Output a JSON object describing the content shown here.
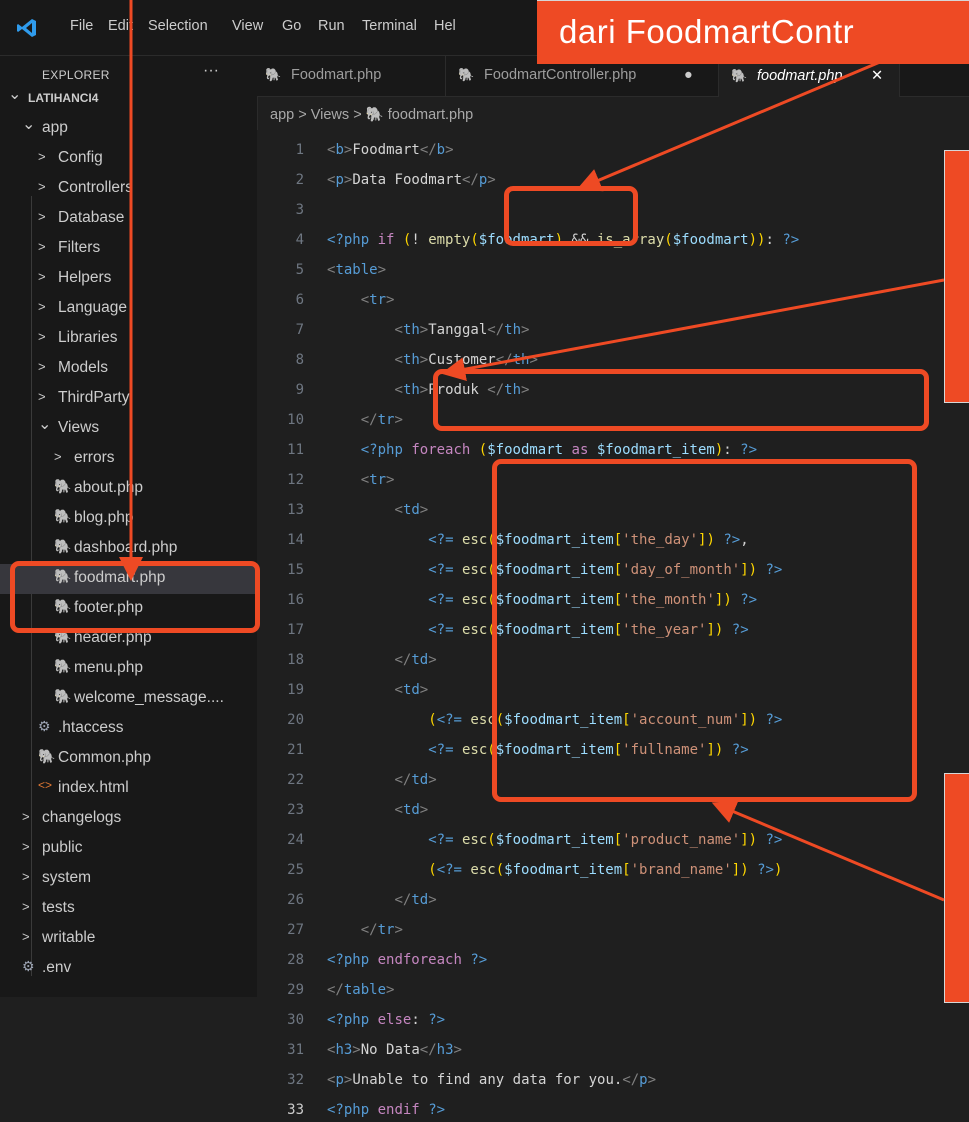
{
  "titlebar": {
    "menu": [
      "File",
      "Edit",
      "Selection",
      "View",
      "Go",
      "Run",
      "Terminal",
      "Hel"
    ]
  },
  "callout": {
    "top_text": "dari FoodmartContr"
  },
  "sidebar": {
    "title": "EXPLORER",
    "more": "···",
    "items": [
      {
        "label": "LATIHANCI4",
        "icon": "chevron-down-icon"
      },
      {
        "label": "app",
        "icon": "chevron-down-icon"
      },
      {
        "label": "Config",
        "icon": "chevron-right-icon"
      },
      {
        "label": "Controllers",
        "icon": "chevron-right-icon"
      },
      {
        "label": "Database",
        "icon": "chevron-right-icon"
      },
      {
        "label": "Filters",
        "icon": "chevron-right-icon"
      },
      {
        "label": "Helpers",
        "icon": "chevron-right-icon"
      },
      {
        "label": "Language",
        "icon": "chevron-right-icon"
      },
      {
        "label": "Libraries",
        "icon": "chevron-right-icon"
      },
      {
        "label": "Models",
        "icon": "chevron-right-icon"
      },
      {
        "label": "ThirdParty",
        "icon": "chevron-right-icon"
      },
      {
        "label": "Views",
        "icon": "chevron-down-icon"
      },
      {
        "label": "errors",
        "icon": "chevron-right-icon"
      },
      {
        "label": "about.php",
        "icon": "php-file-icon"
      },
      {
        "label": "blog.php",
        "icon": "php-file-icon"
      },
      {
        "label": "dashboard.php",
        "icon": "php-file-icon"
      },
      {
        "label": "foodmart.php",
        "icon": "php-file-icon"
      },
      {
        "label": "footer.php",
        "icon": "php-file-icon"
      },
      {
        "label": "header.php",
        "icon": "php-file-icon"
      },
      {
        "label": "menu.php",
        "icon": "php-file-icon"
      },
      {
        "label": "welcome_message....",
        "icon": "php-file-icon"
      },
      {
        "label": ".htaccess",
        "icon": "gear-icon"
      },
      {
        "label": "Common.php",
        "icon": "php-file-icon"
      },
      {
        "label": "index.html",
        "icon": "html-file-icon"
      },
      {
        "label": "changelogs",
        "icon": "chevron-right-icon"
      },
      {
        "label": "public",
        "icon": "chevron-right-icon"
      },
      {
        "label": "system",
        "icon": "chevron-right-icon"
      },
      {
        "label": "tests",
        "icon": "chevron-right-icon"
      },
      {
        "label": "writable",
        "icon": "chevron-right-icon"
      },
      {
        "label": ".env",
        "icon": "gear-icon"
      }
    ]
  },
  "tabs": [
    {
      "label": "Foodmart.php",
      "modified": ""
    },
    {
      "label": "FoodmartController.php",
      "modified": "●"
    },
    {
      "label": "foodmart.php",
      "close": "✕"
    }
  ],
  "breadcrumb": {
    "part1": "app",
    "sep": ">",
    "part2": "Views",
    "part3": "foodmart.php"
  },
  "editor": {
    "current_line": 33,
    "lines": [
      {
        "n": "1",
        "text": "<b>Foodmart</b>"
      },
      {
        "n": "2",
        "text": "<p>Data Foodmart</p>"
      },
      {
        "n": "3",
        "text": ""
      },
      {
        "n": "4",
        "text": "<?php if (! empty($foodmart) && is_array($foodmart)): ?>"
      },
      {
        "n": "5",
        "text": "<table>"
      },
      {
        "n": "6",
        "text": "    <tr>"
      },
      {
        "n": "7",
        "text": "        <th>Tanggal</th>"
      },
      {
        "n": "8",
        "text": "        <th>Customer</th>"
      },
      {
        "n": "9",
        "text": "        <th>Produk </th>"
      },
      {
        "n": "10",
        "text": "    </tr>"
      },
      {
        "n": "11",
        "text": "    <?php foreach ($foodmart as $foodmart_item): ?>"
      },
      {
        "n": "12",
        "text": "    <tr>"
      },
      {
        "n": "13",
        "text": "        <td>"
      },
      {
        "n": "14",
        "text": "            <?= esc($foodmart_item['the_day']) ?>,"
      },
      {
        "n": "15",
        "text": "            <?= esc($foodmart_item['day_of_month']) ?>"
      },
      {
        "n": "16",
        "text": "            <?= esc($foodmart_item['the_month']) ?>"
      },
      {
        "n": "17",
        "text": "            <?= esc($foodmart_item['the_year']) ?>"
      },
      {
        "n": "18",
        "text": "        </td>"
      },
      {
        "n": "19",
        "text": "        <td>"
      },
      {
        "n": "20",
        "text": "            (<?= esc($foodmart_item['account_num']) ?>"
      },
      {
        "n": "21",
        "text": "            <?= esc($foodmart_item['fullname']) ?>"
      },
      {
        "n": "22",
        "text": "        </td>"
      },
      {
        "n": "23",
        "text": "        <td>"
      },
      {
        "n": "24",
        "text": "            <?= esc($foodmart_item['product_name']) ?>"
      },
      {
        "n": "25",
        "text": "            (<?= esc($foodmart_item['brand_name']) ?>)"
      },
      {
        "n": "26",
        "text": "        </td>"
      },
      {
        "n": "27",
        "text": "    </tr>"
      },
      {
        "n": "28",
        "text": "<?php endforeach ?>"
      },
      {
        "n": "29",
        "text": "</table>"
      },
      {
        "n": "30",
        "text": "<?php else: ?>"
      },
      {
        "n": "31",
        "text": "<h3>No Data</h3>"
      },
      {
        "n": "32",
        "text": "<p>Unable to find any data for you.</p>"
      },
      {
        "n": "33",
        "text": "<?php endif ?>"
      }
    ]
  },
  "colors": {
    "annotation": "#ee4a24",
    "editor_bg": "#1f1f1f",
    "sidebar_bg": "#181818",
    "selection_bg": "#37373d"
  }
}
